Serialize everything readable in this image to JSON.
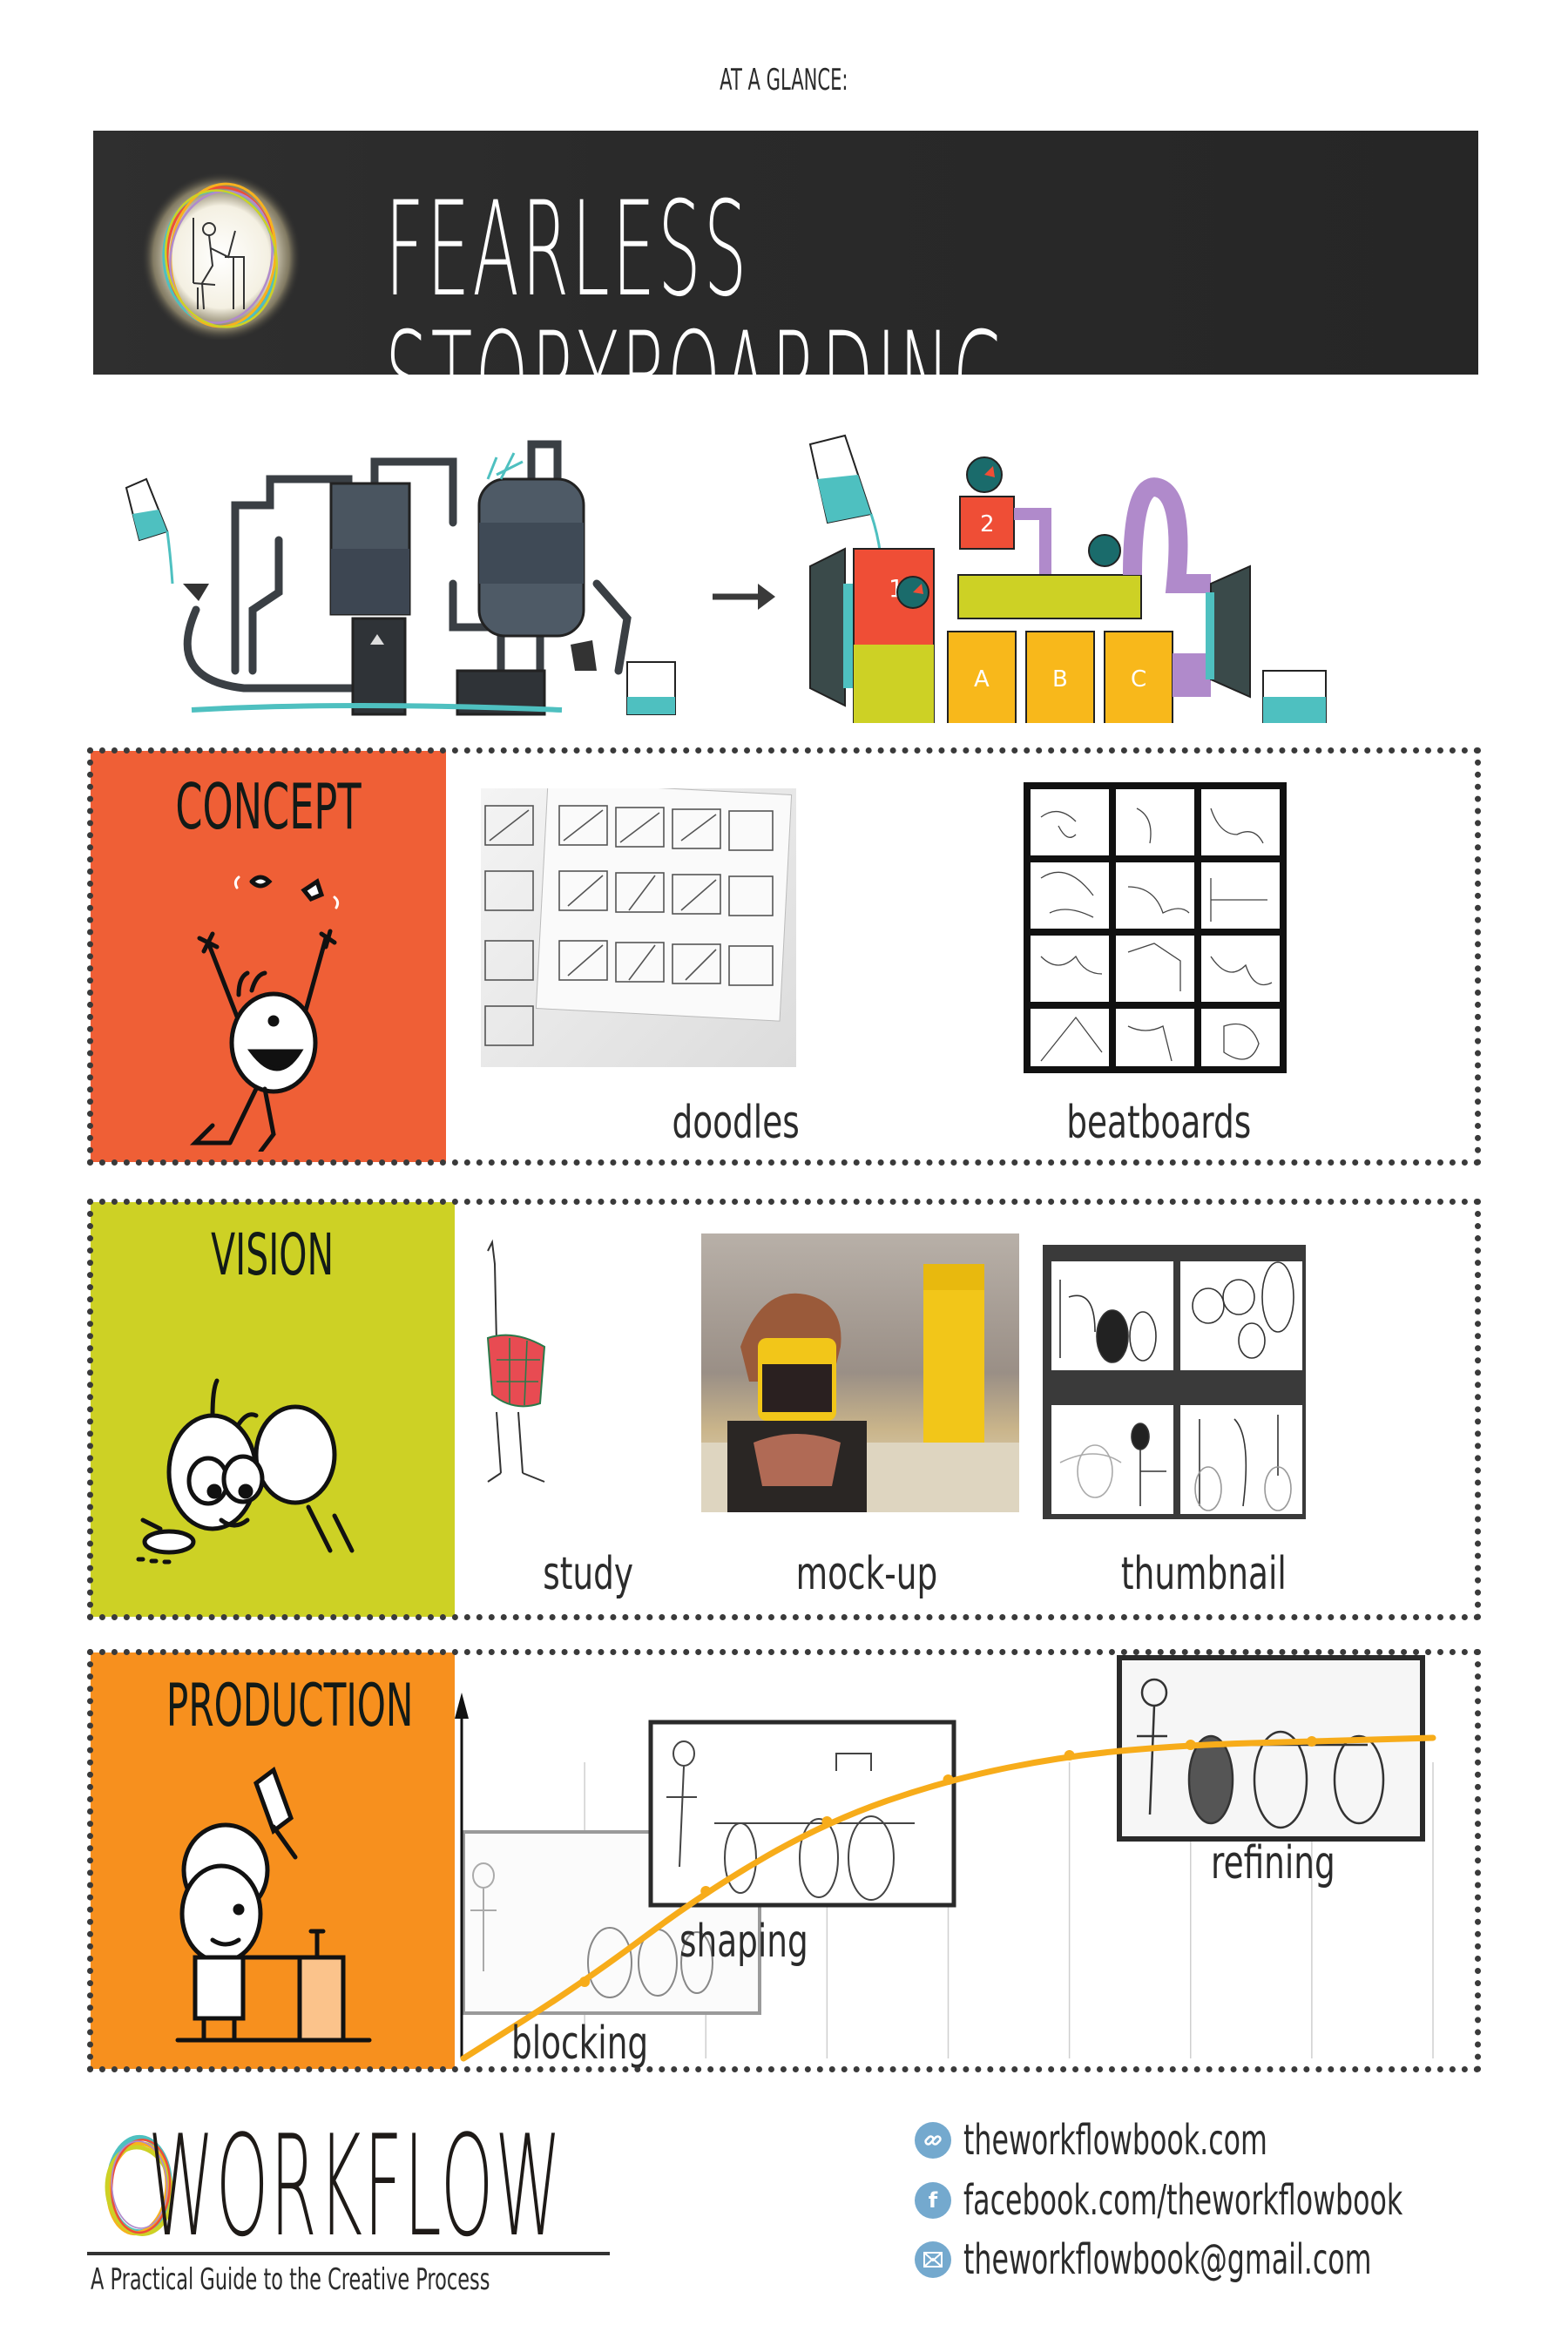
{
  "header": {
    "eyebrow": "AT A GLANCE:",
    "title": "FEARLESS STORYBOARDING"
  },
  "illustration": {
    "left": "messy-machine",
    "arrow": "arrow-right",
    "right": "organized-machine",
    "labels": [
      "1",
      "2",
      "A",
      "B",
      "C"
    ]
  },
  "sections": {
    "concept": {
      "title": "CONCEPT",
      "color": "#EF5F36",
      "items": [
        {
          "caption": "doodles",
          "kind": "sketch-sheets"
        },
        {
          "caption": "beatboards",
          "kind": "sketch-grid"
        }
      ]
    },
    "vision": {
      "title": "VISION",
      "color": "#CDD125",
      "items": [
        {
          "caption": "study",
          "kind": "bird-drawing"
        },
        {
          "caption": "mock-up",
          "kind": "lego-photo"
        },
        {
          "caption": "thumbnail",
          "kind": "sketch-grid"
        }
      ]
    },
    "production": {
      "title": "PRODUCTION",
      "color": "#F7901E",
      "stages": [
        {
          "caption": "blocking"
        },
        {
          "caption": "shaping"
        },
        {
          "caption": "refining"
        }
      ]
    }
  },
  "chart_data": {
    "type": "line",
    "title": "",
    "xlabel": "",
    "ylabel": "",
    "grid": true,
    "x": [
      0,
      1,
      2,
      3,
      4,
      5,
      6,
      7,
      8
    ],
    "values": [
      0,
      22,
      48,
      68,
      80,
      87,
      90,
      91,
      92
    ],
    "ylim": [
      0,
      100
    ],
    "annotations": [
      "blocking",
      "shaping",
      "refining"
    ],
    "color": "#F7AC1A"
  },
  "footer": {
    "brand": "WORKFLOW",
    "tagline": "A Practical Guide to the Creative Process",
    "contacts": [
      {
        "icon": "link-icon",
        "text": "theworkflowbook.com"
      },
      {
        "icon": "facebook-icon",
        "text": "facebook.com/theworkflowbook"
      },
      {
        "icon": "mail-icon",
        "text": "theworkflowbook@gmail.com"
      }
    ],
    "icon_color": "#74A9CE"
  }
}
